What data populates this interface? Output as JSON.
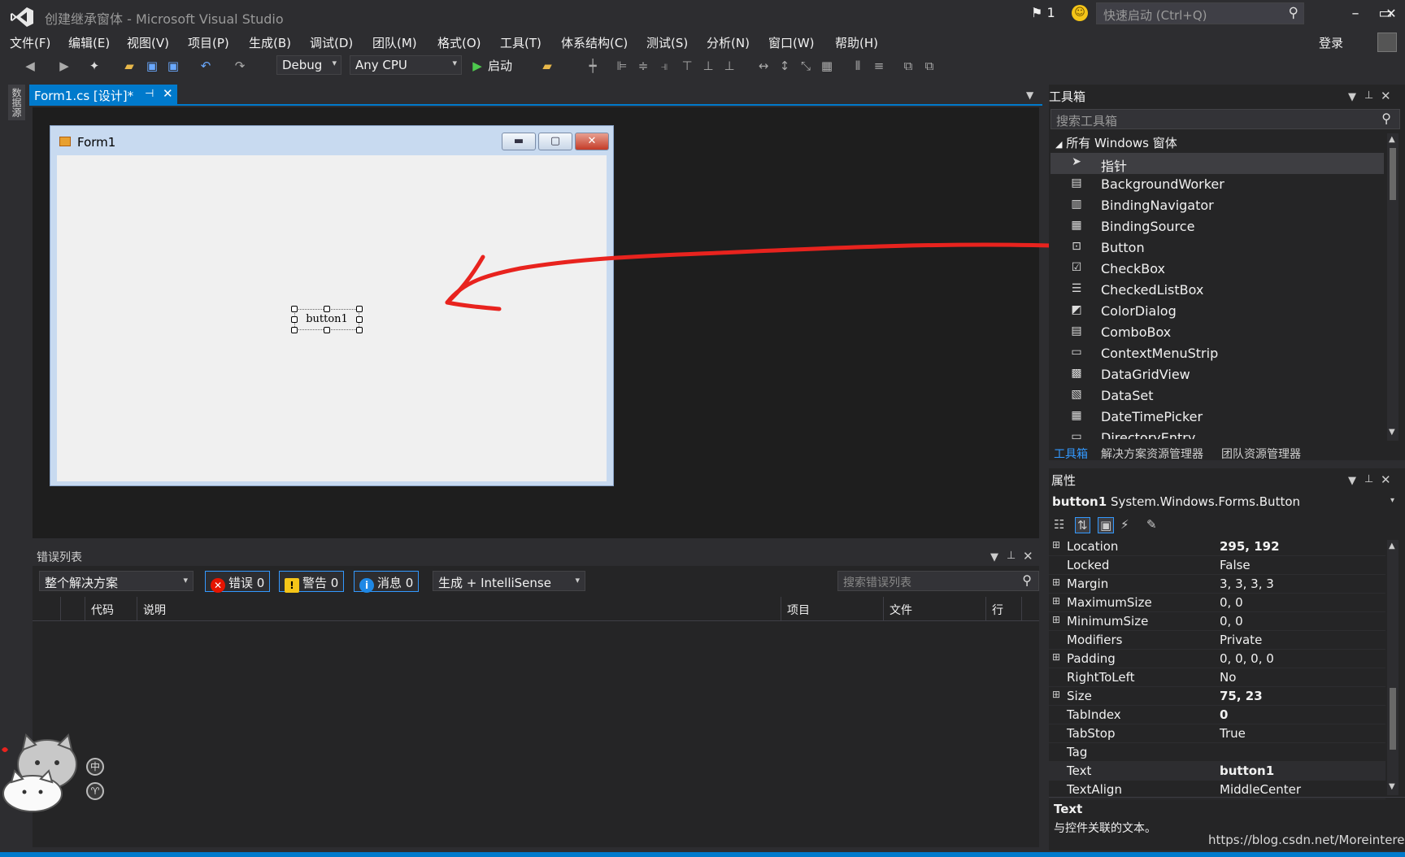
{
  "window": {
    "title": "创建继承窗体 - Microsoft Visual Studio",
    "notifications": "1",
    "quick_launch_placeholder": "快速启动 (Ctrl+Q)",
    "login": "登录"
  },
  "menu": [
    "文件(F)",
    "编辑(E)",
    "视图(V)",
    "项目(P)",
    "生成(B)",
    "调试(D)",
    "团队(M)",
    "格式(O)",
    "工具(T)",
    "体系结构(C)",
    "测试(S)",
    "分析(N)",
    "窗口(W)",
    "帮助(H)"
  ],
  "toolbar": {
    "config": "Debug",
    "platform": "Any CPU",
    "start": "启动"
  },
  "left_strip": {
    "label": "数据源"
  },
  "document": {
    "tab_label": "Form1.cs [设计]*",
    "form_title": "Form1",
    "button_text": "button1"
  },
  "error_list": {
    "title": "错误列表",
    "scope": "整个解决方案",
    "errors": "错误 0",
    "warnings": "警告 0",
    "messages": "消息 0",
    "build_filter": "生成 + IntelliSense",
    "search_placeholder": "搜索错误列表",
    "columns": [
      "代码",
      "说明",
      "项目",
      "文件",
      "行"
    ]
  },
  "mascot": {
    "badge1": "中",
    "badge2": "♈"
  },
  "toolbox": {
    "title": "工具箱",
    "search_placeholder": "搜索工具箱",
    "group": "所有 Windows 窗体",
    "items": [
      "指针",
      "BackgroundWorker",
      "BindingNavigator",
      "BindingSource",
      "Button",
      "CheckBox",
      "CheckedListBox",
      "ColorDialog",
      "ComboBox",
      "ContextMenuStrip",
      "DataGridView",
      "DataSet",
      "DateTimePicker",
      "DirectoryEntry"
    ],
    "bottom_tabs": [
      "工具箱",
      "解决方案资源管理器",
      "团队资源管理器"
    ]
  },
  "properties": {
    "title": "属性",
    "object_name": "button1",
    "object_type": "System.Windows.Forms.Button",
    "rows": [
      {
        "expand": "⊞",
        "name": "Location",
        "value": "295, 192",
        "bold": true
      },
      {
        "expand": "",
        "name": "Locked",
        "value": "False",
        "bold": false
      },
      {
        "expand": "⊞",
        "name": "Margin",
        "value": "3, 3, 3, 3",
        "bold": false
      },
      {
        "expand": "⊞",
        "name": "MaximumSize",
        "value": "0, 0",
        "bold": false
      },
      {
        "expand": "⊞",
        "name": "MinimumSize",
        "value": "0, 0",
        "bold": false
      },
      {
        "expand": "",
        "name": "Modifiers",
        "value": "Private",
        "bold": false
      },
      {
        "expand": "⊞",
        "name": "Padding",
        "value": "0, 0, 0, 0",
        "bold": false
      },
      {
        "expand": "",
        "name": "RightToLeft",
        "value": "No",
        "bold": false
      },
      {
        "expand": "⊞",
        "name": "Size",
        "value": "75, 23",
        "bold": true
      },
      {
        "expand": "",
        "name": "TabIndex",
        "value": "0",
        "bold": true
      },
      {
        "expand": "",
        "name": "TabStop",
        "value": "True",
        "bold": false
      },
      {
        "expand": "",
        "name": "Tag",
        "value": "",
        "bold": false
      },
      {
        "expand": "",
        "name": "Text",
        "value": "button1",
        "bold": true
      },
      {
        "expand": "",
        "name": "TextAlign",
        "value": "MiddleCenter",
        "bold": false
      }
    ],
    "description_title": "Text",
    "description_text": "与控件关联的文本。"
  },
  "watermark": "https://blog.csdn.net/Moreinterest",
  "colors": {
    "accent": "#007acc",
    "background": "#2d2d30",
    "arrow": "#e8231e"
  }
}
